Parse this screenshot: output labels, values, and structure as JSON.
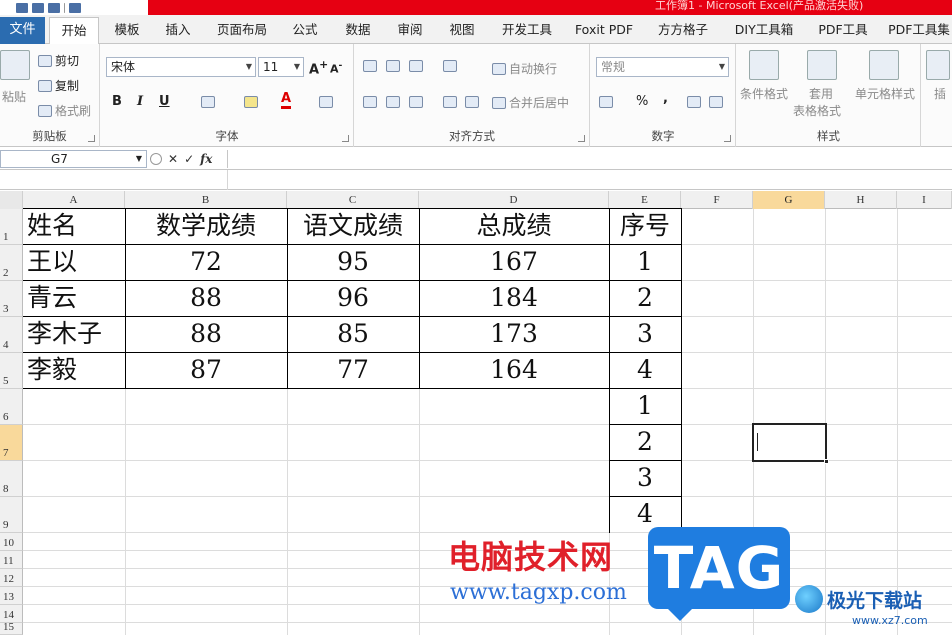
{
  "window": {
    "title": "工作簿1 - Microsoft Excel(产品激活失败)"
  },
  "tabs": [
    {
      "label": "文件"
    },
    {
      "label": "开始"
    },
    {
      "label": "模板"
    },
    {
      "label": "插入"
    },
    {
      "label": "页面布局"
    },
    {
      "label": "公式"
    },
    {
      "label": "数据"
    },
    {
      "label": "审阅"
    },
    {
      "label": "视图"
    },
    {
      "label": "开发工具"
    },
    {
      "label": "Foxit PDF"
    },
    {
      "label": "方方格子"
    },
    {
      "label": "DIY工具箱"
    },
    {
      "label": "PDF工具"
    },
    {
      "label": "PDF工具集"
    }
  ],
  "ribbon": {
    "clipboard": {
      "label": "剪贴板",
      "paste": "粘贴",
      "cut": "剪切",
      "copy": "复制",
      "format_painter": "格式刷"
    },
    "font": {
      "label": "字体",
      "font_name": "宋体",
      "font_size": "11",
      "bold": "B",
      "italic": "I",
      "underline": "U"
    },
    "alignment": {
      "label": "对齐方式",
      "wrap": "自动换行",
      "merge": "合并后居中"
    },
    "number": {
      "label": "数字",
      "format": "常规",
      "percent": "%",
      "comma": ","
    },
    "styles": {
      "label": "样式",
      "conditional": "条件格式",
      "table1": "套用",
      "table2": "表格格式",
      "cell_styles": "单元格样式"
    },
    "cells": {
      "insert": "插"
    }
  },
  "formula_bar": {
    "name_box": "G7",
    "fx": "fx",
    "formula": ""
  },
  "columns": [
    "A",
    "B",
    "C",
    "D",
    "E",
    "F",
    "G",
    "H",
    "I"
  ],
  "rows": [
    "1",
    "2",
    "3",
    "4",
    "5",
    "6",
    "7",
    "8",
    "9",
    "10",
    "11",
    "12",
    "13",
    "14",
    "15"
  ],
  "selected_cell": {
    "column": "G",
    "row": "7"
  },
  "table": {
    "headers": [
      "姓名",
      "数学成绩",
      "语文成绩",
      "总成绩",
      "序号"
    ],
    "rows": [
      [
        "王以",
        "72",
        "95",
        "167",
        "1"
      ],
      [
        "青云",
        "88",
        "96",
        "184",
        "2"
      ],
      [
        "李木子",
        "88",
        "85",
        "173",
        "3"
      ],
      [
        "李毅",
        "87",
        "77",
        "164",
        "4"
      ]
    ],
    "extra_serials": [
      "1",
      "2",
      "3",
      "4"
    ]
  },
  "watermark": {
    "site_name": "电脑技术网",
    "site_url": "www.tagxp.com",
    "tag": "TAG",
    "logo_name": "极光下载站",
    "logo_url": "www.xz7.com"
  }
}
